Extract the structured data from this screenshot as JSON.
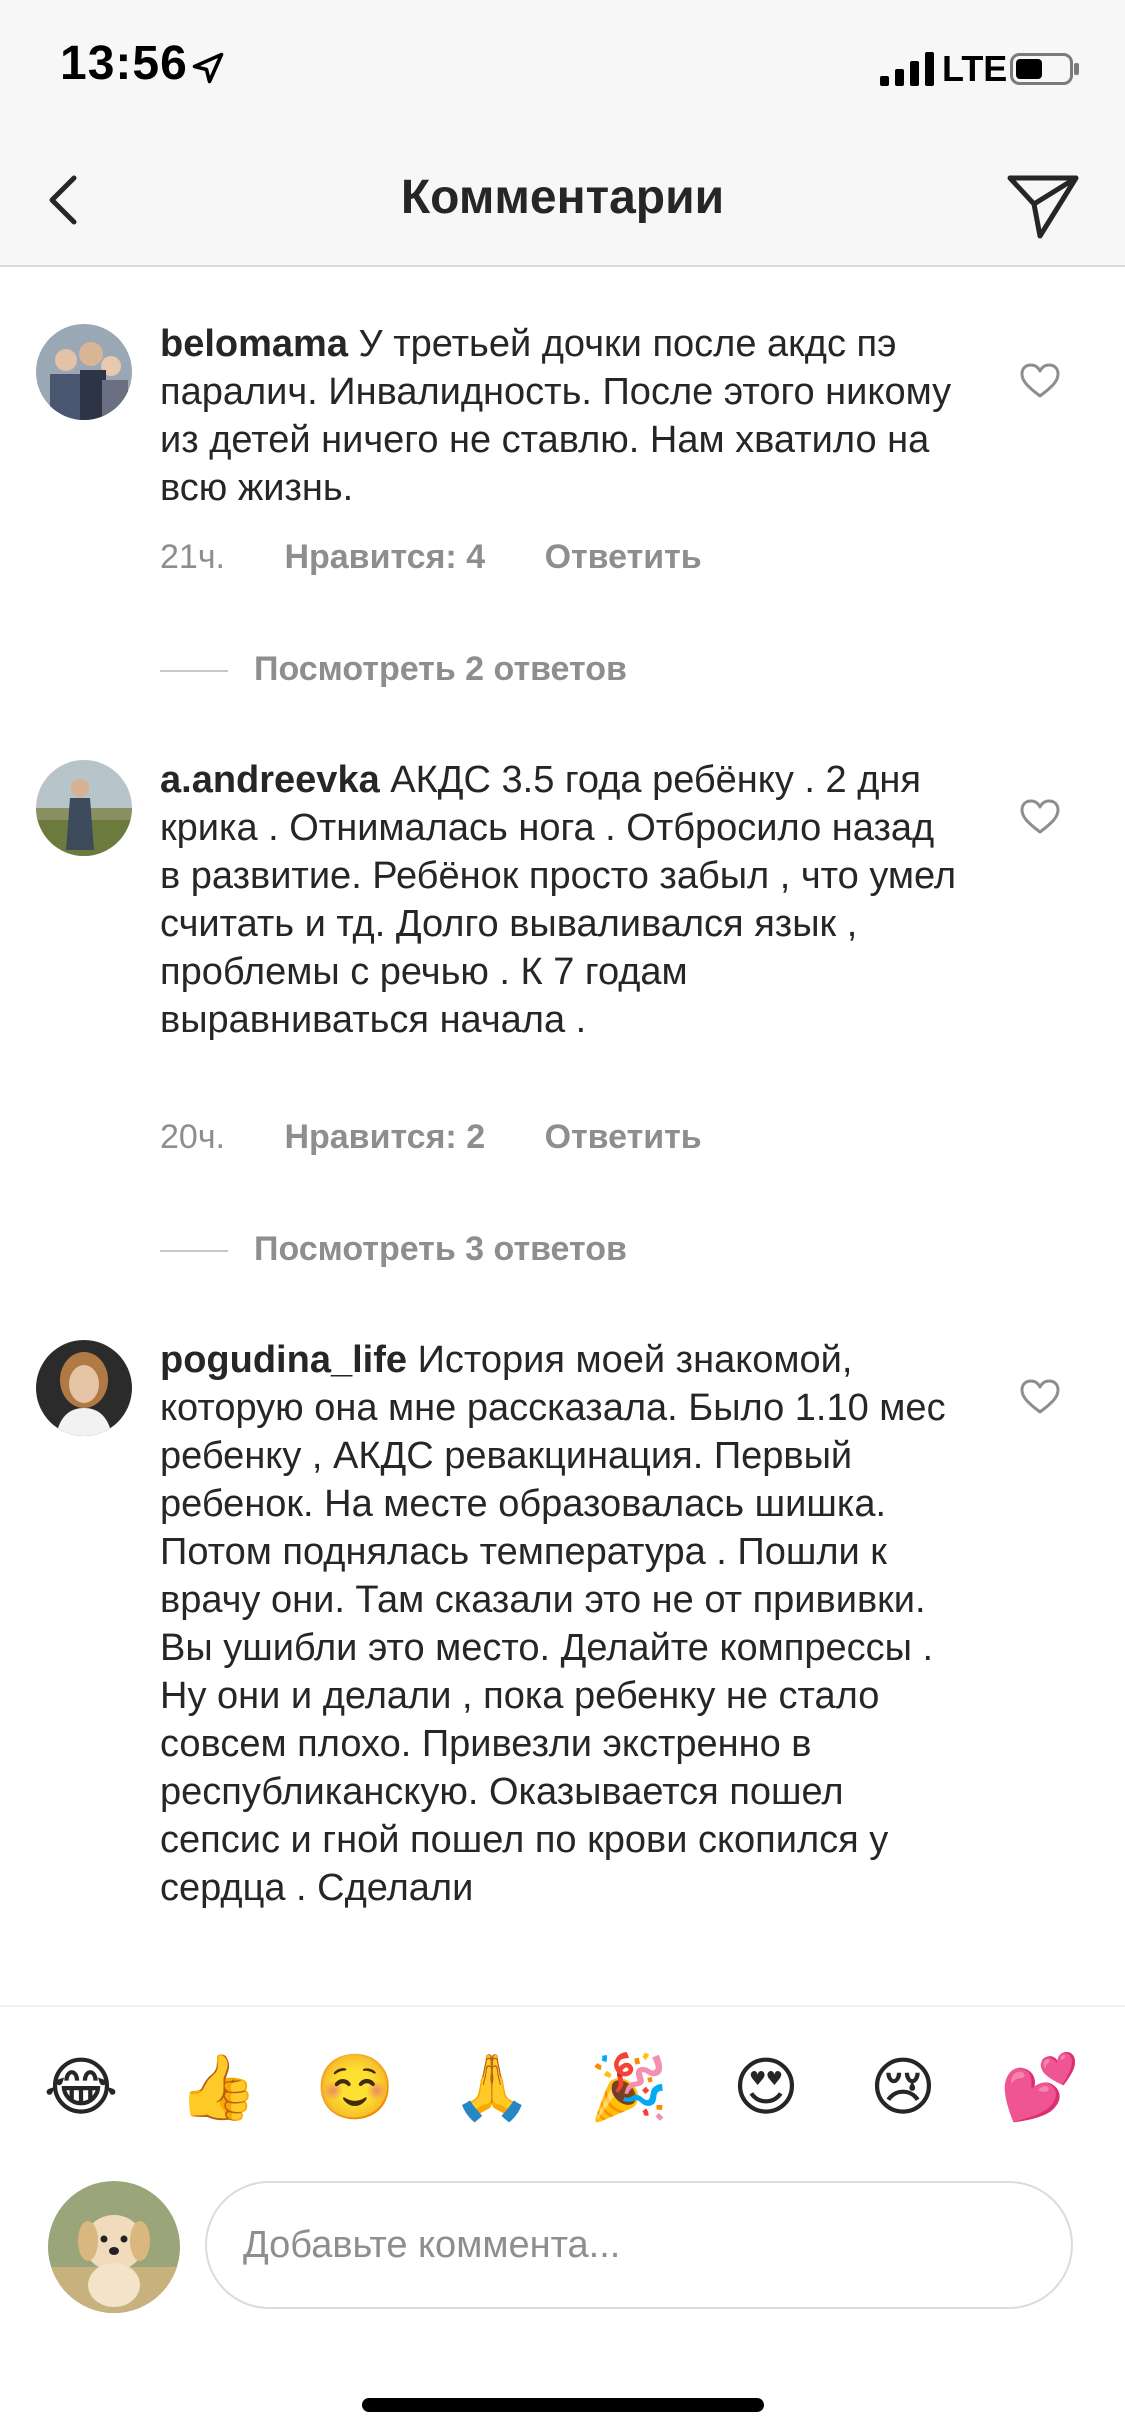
{
  "status_bar": {
    "time": "13:56",
    "network": "LTE"
  },
  "header": {
    "title": "Комментарии"
  },
  "comments": [
    {
      "username": "belomama",
      "text": "У третьей дочки после акдс пэ паралич. Инвалидность. После этого никому из детей ничего не ставлю. Нам хватило на всю жизнь.",
      "time": "21ч.",
      "likes": "Нравится: 4",
      "reply_label": "Ответить",
      "view_replies": "Посмотреть 2 ответов"
    },
    {
      "username": "a.andreevka",
      "text": "АКДС 3.5 года ребёнку . 2 дня крика . Отнималась нога . Отбросило назад  в развитие. Ребёнок просто забыл , что умел считать и тд. Долго вываливался язык , проблемы с речью .  К 7 годам выравниваться начала .",
      "time": "20ч.",
      "likes": "Нравится: 2",
      "reply_label": "Ответить",
      "view_replies": "Посмотреть 3 ответов"
    },
    {
      "username": "pogudina_life",
      "text": "История моей знакомой, которую она мне рассказала. Было 1.10 мес ребенку , АКДС ревакцинация. Первый ребенок. На месте образовалась шишка. Потом поднялась температура . Пошли к врачу они. Там сказали это не от прививки. Вы ушибли это место. Делайте компрессы . Ну они и делали , пока ребенку не стало совсем плохо. Привезли экстренно в республиканскую.  Оказывается пошел сепсис и гной пошел по крови скопился у сердца . Сделали"
    }
  ],
  "emoji_bar": [
    "😂",
    "👍",
    "☺️",
    "🙏",
    "🎉",
    "😍",
    "😢",
    "💕"
  ],
  "comment_input": {
    "placeholder": "Добавьте коммента..."
  },
  "colors": {
    "text": "#262626",
    "secondary": "#8e8e8e",
    "bar_bg": "#f7f7f7",
    "divider": "#dbdbdb"
  }
}
